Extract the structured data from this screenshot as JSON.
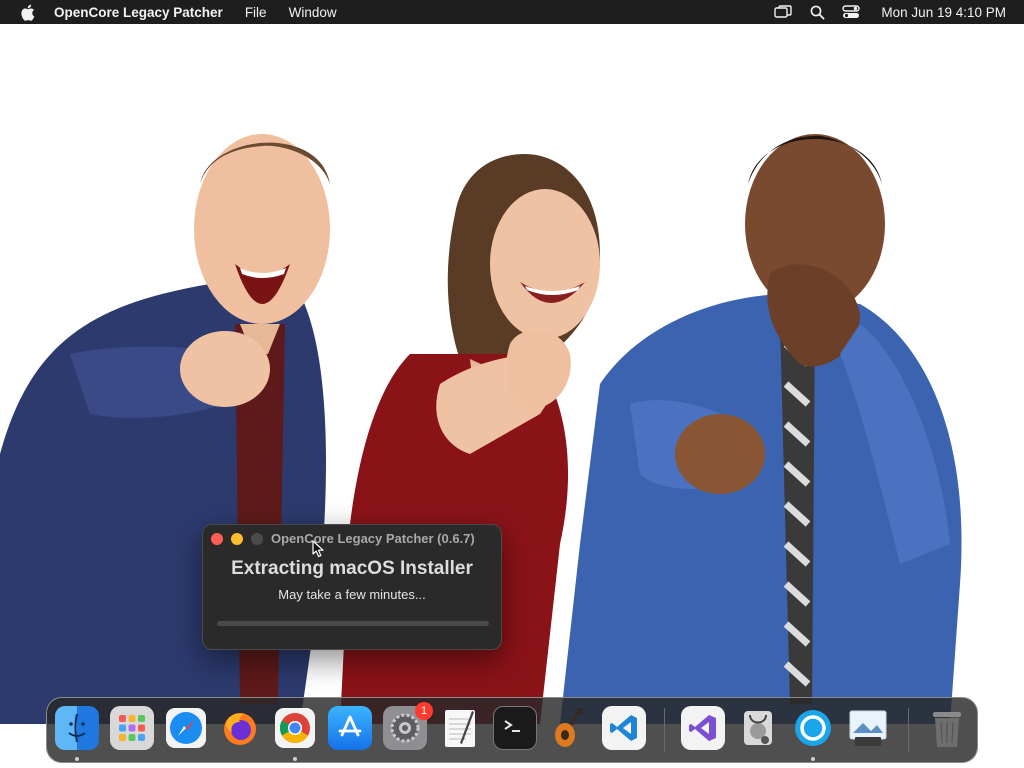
{
  "menubar": {
    "app_name": "OpenCore Legacy Patcher",
    "menus": [
      "File",
      "Window"
    ],
    "clock": "Mon Jun 19  4:10 PM",
    "icons": [
      "apple-icon",
      "screen-mirroring-icon",
      "spotlight-search-icon",
      "control-center-icon"
    ]
  },
  "dialog": {
    "title": "OpenCore Legacy Patcher (0.6.7)",
    "heading": "Extracting macOS Installer",
    "subtitle": "May take a few minutes...",
    "progress": 0,
    "buttons": [
      "close",
      "minimize",
      "zoom"
    ]
  },
  "dock": {
    "items": [
      {
        "name": "Finder",
        "running": true
      },
      {
        "name": "Launchpad",
        "running": false
      },
      {
        "name": "Safari",
        "running": false
      },
      {
        "name": "Firefox",
        "running": false
      },
      {
        "name": "Google Chrome",
        "running": true
      },
      {
        "name": "App Store",
        "running": false
      },
      {
        "name": "System Preferences",
        "running": false,
        "badge": "1"
      },
      {
        "name": "TextEdit",
        "running": false
      },
      {
        "name": "Terminal",
        "running": false
      },
      {
        "name": "GarageBand",
        "running": false
      },
      {
        "name": "Visual Studio Code",
        "running": false
      },
      {
        "name": "Visual Studio",
        "running": false
      },
      {
        "name": "Disk Utility",
        "running": false
      },
      {
        "name": "OpenCore Legacy Patcher",
        "running": true
      },
      {
        "name": "Preview",
        "running": false
      },
      {
        "name": "Trash",
        "running": false
      }
    ]
  },
  "colors": {
    "menubar_bg": "#1e1e1e",
    "dialog_bg": "#2a2a2a",
    "close": "#ff5f57",
    "minimize": "#febc2e",
    "zoom": "#4b4b4b",
    "badge": "#ff3b30"
  }
}
